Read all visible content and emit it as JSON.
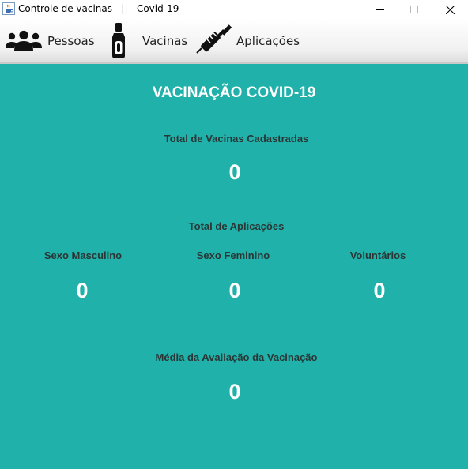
{
  "window": {
    "title": "Controle de vacinas   ||   Covid-19",
    "app_icon": "java-cup-icon",
    "controls": [
      "minimize-icon",
      "maximize-icon",
      "close-icon"
    ]
  },
  "menu": {
    "items": [
      {
        "label": "Pessoas",
        "icon": "people-icon"
      },
      {
        "label": "Vacinas",
        "icon": "vaccine-vial-icon"
      },
      {
        "label": "Aplicações",
        "icon": "syringe-icon"
      }
    ]
  },
  "dashboard": {
    "title": "VACINAÇÃO COVID-19",
    "vaccines_label": "Total de Vacinas Cadastradas",
    "vaccines_value": "0",
    "applications_label": "Total de Aplicações",
    "male_label": "Sexo Masculino",
    "male_value": "0",
    "female_label": "Sexo Feminino",
    "female_value": "0",
    "volunteers_label": "Voluntários",
    "volunteers_value": "0",
    "rating_label": "Média da Avaliação da Vacinação",
    "rating_value": "0"
  },
  "colors": {
    "content_background": "#20b2aa",
    "heading_text": "#ffffff",
    "label_text": "#2a3535"
  }
}
